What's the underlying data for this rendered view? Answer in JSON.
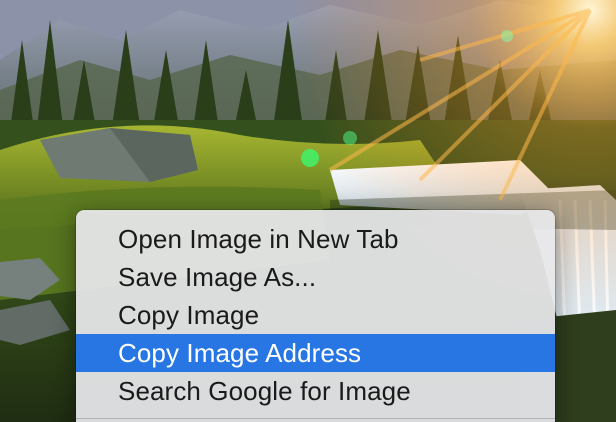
{
  "background": {
    "description_icon": "landscape-photo",
    "colors": {
      "sky": "#8a90a4",
      "foliage": "#3d5a1f",
      "grass": "#8fa62a",
      "water": "#e8eef2",
      "sun": "#ff9a2a"
    }
  },
  "context_menu": {
    "items": [
      {
        "label": "Open Image in New Tab",
        "highlighted": false
      },
      {
        "label": "Save Image As...",
        "highlighted": false
      },
      {
        "label": "Copy Image",
        "highlighted": false
      },
      {
        "label": "Copy Image Address",
        "highlighted": true
      },
      {
        "label": "Search Google for Image",
        "highlighted": false
      }
    ],
    "highlight_color": "#2776e3"
  }
}
